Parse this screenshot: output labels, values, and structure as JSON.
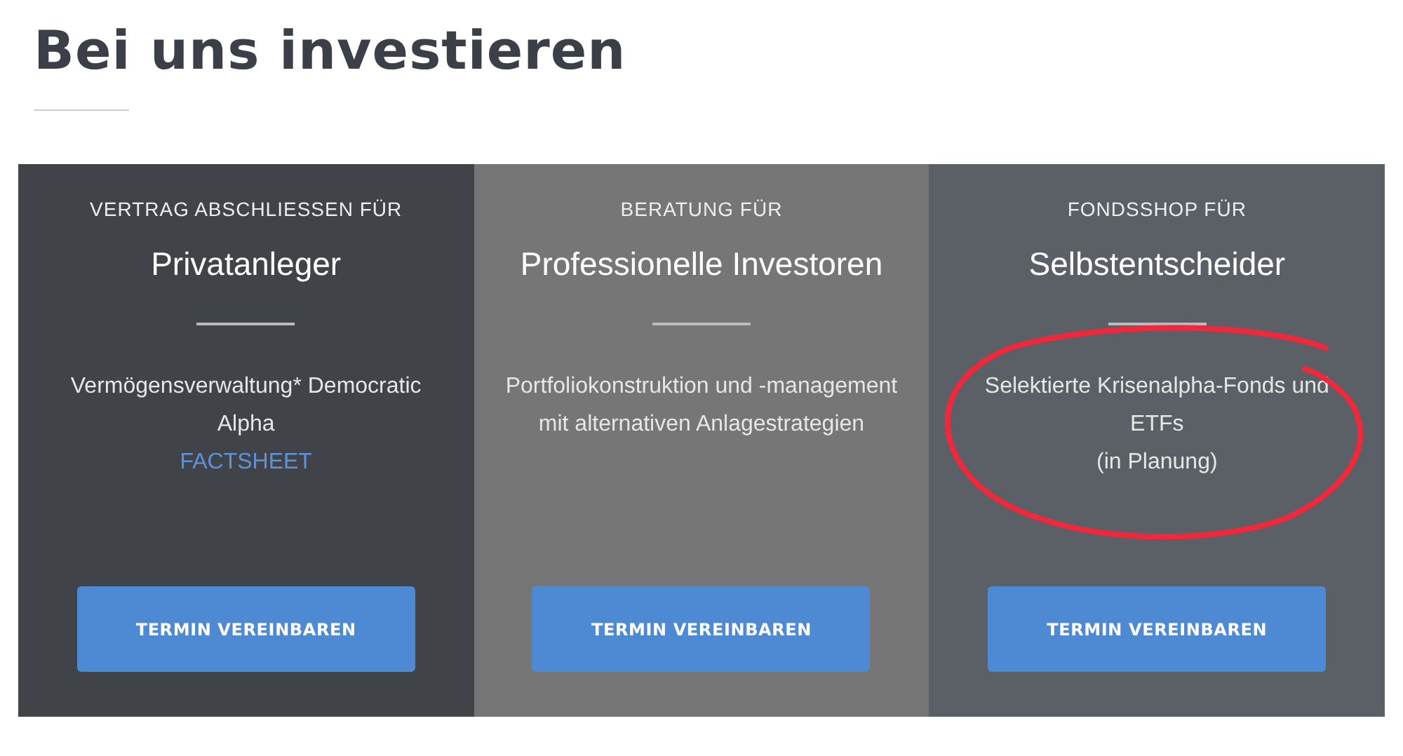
{
  "heading": "Bei uns investieren",
  "cards": [
    {
      "eyebrow": "VERTRAG ABSCHLIESSEN FÜR",
      "title": "Privatanleger",
      "paragraphs": [
        "Vermögensverwaltung* Democratic Alpha"
      ],
      "link": "FACTSHEET",
      "button": "TERMIN VEREINBAREN",
      "color": "#404348"
    },
    {
      "eyebrow": "BERATUNG FÜR",
      "title": "Professionelle Investoren",
      "paragraphs": [
        "Portfoliokonstruktion und -management mit alternativen Anlagestrategien"
      ],
      "button": "TERMIN VEREINBAREN",
      "color": "#767676"
    },
    {
      "eyebrow": "FONDSSHOP FÜR",
      "title": "Selbstentscheider",
      "paragraphs": [
        "Selektierte Krisenalpha-Fonds und ETFs",
        "(in Planung)"
      ],
      "button": "TERMIN VEREINBAREN",
      "color": "#5b5f66"
    }
  ]
}
